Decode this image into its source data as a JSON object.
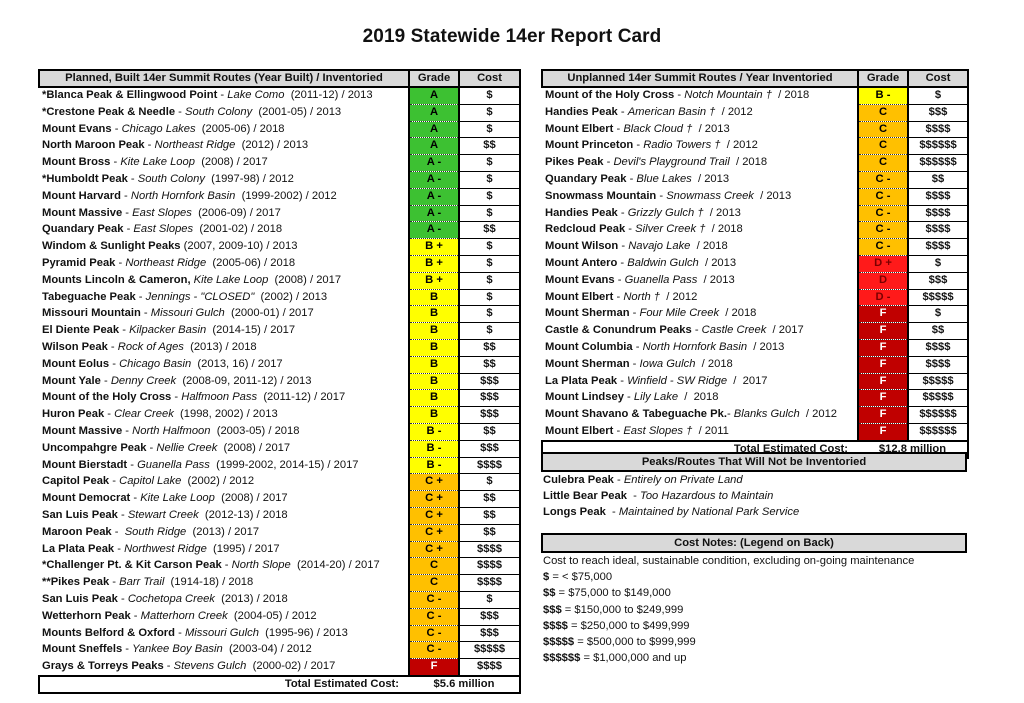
{
  "title": "2019 Statewide 14er Report Card",
  "colors": {
    "A": "#3dc132",
    "B": "#ffff00",
    "C": "#ffc000",
    "D": "#ff1a1a",
    "F": "#c00000",
    "header_bg": "#d9d9d9"
  },
  "planned": {
    "header": {
      "route": "Planned, Built 14er Summit Routes  (Year Built) / Inventoried",
      "grade": "Grade",
      "cost": "Cost"
    },
    "rows": [
      {
        "peak": "*Blanca Peak & Ellingwood Point",
        "sep": " - ",
        "route": "Lake Como",
        "years": "  (2011-12) / 2013",
        "grade": "A",
        "cost": "$"
      },
      {
        "peak": "*Crestone Peak & Needle",
        "sep": " - ",
        "route": "South Colony",
        "years": "  (2001-05) / 2013",
        "grade": "A",
        "cost": "$"
      },
      {
        "peak": "Mount Evans",
        "sep": " - ",
        "route": "Chicago Lakes",
        "years": "  (2005-06) / 2018",
        "grade": "A",
        "cost": "$"
      },
      {
        "peak": "North Maroon Peak",
        "sep": " - ",
        "route": "Northeast Ridge",
        "years": "  (2012) / 2013",
        "grade": "A",
        "cost": "$$"
      },
      {
        "peak": "Mount Bross",
        "sep": " - ",
        "route": "Kite Lake Loop",
        "years": "  (2008) / 2017",
        "grade": "A -",
        "cost": "$"
      },
      {
        "peak": "*Humboldt Peak",
        "sep": " - ",
        "route": "South Colony",
        "years": "  (1997-98) / 2012",
        "grade": "A -",
        "cost": "$"
      },
      {
        "peak": "Mount Harvard",
        "sep": " - ",
        "route": "North Hornfork Basin",
        "years": "  (1999-2002) / 2012",
        "grade": "A -",
        "cost": "$"
      },
      {
        "peak": "Mount Massive",
        "sep": " - ",
        "route": "East Slopes",
        "years": "  (2006-09) / 2017",
        "grade": "A -",
        "cost": "$"
      },
      {
        "peak": "Quandary Peak",
        "sep": " - ",
        "route": "East Slopes",
        "years": "  (2001-02) / 2018",
        "grade": "A -",
        "cost": "$$"
      },
      {
        "peak": "Windom & Sunlight Peaks",
        "sep": "",
        "route": "",
        "years": " (2007, 2009-10) / 2013",
        "grade": "B +",
        "cost": "$"
      },
      {
        "peak": "Pyramid Peak",
        "sep": " - ",
        "route": "Northeast Ridge",
        "years": "  (2005-06) / 2018",
        "grade": "B +",
        "cost": "$"
      },
      {
        "peak": "Mounts Lincoln & Cameron,",
        "sep": " ",
        "route": "Kite Lake Loop",
        "years": "  (2008) / 2017",
        "grade": "B +",
        "cost": "$"
      },
      {
        "peak": "Tabeguache Peak",
        "sep": " - ",
        "route": "Jennings - \"CLOSED\"",
        "years": "  (2002) / 2013",
        "grade": "B",
        "cost": "$"
      },
      {
        "peak": "Missouri Mountain",
        "sep": " - ",
        "route": "Missouri Gulch",
        "years": "  (2000-01) / 2017",
        "grade": "B",
        "cost": "$"
      },
      {
        "peak": "El Diente Peak",
        "sep": " - ",
        "route": "Kilpacker Basin",
        "years": "  (2014-15) / 2017",
        "grade": "B",
        "cost": "$"
      },
      {
        "peak": "Wilson Peak",
        "sep": " - ",
        "route": "Rock of Ages",
        "years": "  (2013) / 2018",
        "grade": "B",
        "cost": "$$"
      },
      {
        "peak": "Mount Eolus",
        "sep": " - ",
        "route": "Chicago Basin",
        "years": "  (2013, 16) / 2017",
        "grade": "B",
        "cost": "$$"
      },
      {
        "peak": "Mount Yale",
        "sep": " - ",
        "route": "Denny Creek",
        "years": "  (2008-09, 2011-12) / 2013",
        "grade": "B",
        "cost": "$$$"
      },
      {
        "peak": "Mount of the Holy Cross",
        "sep": " - ",
        "route": "Halfmoon Pass",
        "years": "  (2011-12) / 2017",
        "grade": "B",
        "cost": "$$$"
      },
      {
        "peak": "Huron Peak",
        "sep": " - ",
        "route": "Clear Creek",
        "years": "  (1998, 2002) / 2013",
        "grade": "B",
        "cost": "$$$"
      },
      {
        "peak": "Mount Massive",
        "sep": " - ",
        "route": "North Halfmoon",
        "years": "  (2003-05) / 2018",
        "grade": "B -",
        "cost": "$$"
      },
      {
        "peak": "Uncompahgre Peak",
        "sep": " - ",
        "route": "Nellie Creek",
        "years": "  (2008) / 2017",
        "grade": "B -",
        "cost": "$$$"
      },
      {
        "peak": "Mount Bierstadt",
        "sep": " - ",
        "route": "Guanella Pass",
        "years": "  (1999-2002, 2014-15) / 2017",
        "grade": "B -",
        "cost": "$$$$"
      },
      {
        "peak": "Capitol Peak",
        "sep": " - ",
        "route": "Capitol Lake",
        "years": "  (2002) / 2012",
        "grade": "C +",
        "cost": "$"
      },
      {
        "peak": "Mount Democrat",
        "sep": " - ",
        "route": "Kite Lake Loop",
        "years": "  (2008) / 2017",
        "grade": "C +",
        "cost": "$$"
      },
      {
        "peak": "San Luis Peak",
        "sep": " - ",
        "route": "Stewart Creek",
        "years": "  (2012-13) / 2018",
        "grade": "C +",
        "cost": "$$"
      },
      {
        "peak": "Maroon Peak",
        "sep": " -  ",
        "route": "South Ridge",
        "years": "  (2013) / 2017",
        "grade": "C +",
        "cost": "$$"
      },
      {
        "peak": "La Plata Peak",
        "sep": " - ",
        "route": "Northwest Ridge",
        "years": "  (1995) / 2017",
        "grade": "C +",
        "cost": "$$$$"
      },
      {
        "peak": "*Challenger Pt. & Kit Carson Peak",
        "sep": " - ",
        "route": "North Slope",
        "years": "  (2014-20) / 2017",
        "grade": "C",
        "cost": "$$$$"
      },
      {
        "peak": "**Pikes Peak",
        "sep": " - ",
        "route": "Barr Trail",
        "years": "  (1914-18) / 2018",
        "grade": "C",
        "cost": "$$$$"
      },
      {
        "peak": "San Luis Peak",
        "sep": " - ",
        "route": "Cochetopa Creek",
        "years": "  (2013) / 2018",
        "grade": "C -",
        "cost": "$"
      },
      {
        "peak": "Wetterhorn Peak",
        "sep": " - ",
        "route": "Matterhorn Creek",
        "years": "  (2004-05) / 2012",
        "grade": "C -",
        "cost": "$$$"
      },
      {
        "peak": "Mounts Belford & Oxford",
        "sep": " - ",
        "route": "Missouri Gulch",
        "years": "  (1995-96) / 2013",
        "grade": "C -",
        "cost": "$$$"
      },
      {
        "peak": "Mount Sneffels",
        "sep": " - ",
        "route": "Yankee Boy Basin",
        "years": "  (2003-04) / 2012",
        "grade": "C -",
        "cost": "$$$$$"
      },
      {
        "peak": "Grays & Torreys Peaks",
        "sep": " - ",
        "route": "Stevens Gulch",
        "years": "  (2000-02) / 2017",
        "grade": "F",
        "cost": "$$$$"
      }
    ],
    "total_label": "Total Estimated Cost:",
    "total_value": "$5.6 million"
  },
  "unplanned": {
    "header": {
      "route": "Unplanned 14er Summit Routes / Year Inventoried",
      "grade": "Grade",
      "cost": "Cost"
    },
    "rows": [
      {
        "peak": "Mount of the Holy Cross",
        "sep": " - ",
        "route": "Notch Mountain †",
        "years": "  / 2018",
        "grade": "B -",
        "cost": "$"
      },
      {
        "peak": "Handies  Peak",
        "sep": " - ",
        "route": "American Basin †",
        "years": "  / 2012",
        "grade": "C",
        "cost": "$$$"
      },
      {
        "peak": "Mount Elbert",
        "sep": " - ",
        "route": "Black Cloud †",
        "years": "  / 2013",
        "grade": "C",
        "cost": "$$$$"
      },
      {
        "peak": "Mount Princeton",
        "sep": " - ",
        "route": "Radio Towers †",
        "years": "  / 2012",
        "grade": "C",
        "cost": "$$$$$$"
      },
      {
        "peak": "Pikes Peak",
        "sep": " - ",
        "route": "Devil's Playground Trail",
        "years": "  / 2018",
        "grade": "C",
        "cost": "$$$$$$"
      },
      {
        "peak": "Quandary Peak",
        "sep": " - ",
        "route": "Blue Lakes",
        "years": "  / 2013",
        "grade": "C -",
        "cost": "$$"
      },
      {
        "peak": "Snowmass Mountain",
        "sep": " - ",
        "route": "Snowmass Creek",
        "years": "  / 2013",
        "grade": "C -",
        "cost": "$$$$"
      },
      {
        "peak": "Handies Peak",
        "sep": " - ",
        "route": "Grizzly Gulch †",
        "years": "  / 2013",
        "grade": "C -",
        "cost": "$$$$"
      },
      {
        "peak": "Redcloud Peak",
        "sep": " - ",
        "route": "Silver Creek †",
        "years": "  / 2018",
        "grade": "C -",
        "cost": "$$$$"
      },
      {
        "peak": "Mount Wilson",
        "sep": " - ",
        "route": "Navajo Lake",
        "years": "  / 2018",
        "grade": "C -",
        "cost": "$$$$"
      },
      {
        "peak": "Mount Antero",
        "sep": " - ",
        "route": "Baldwin Gulch",
        "years": "  / 2013",
        "grade": "D +",
        "cost": "$"
      },
      {
        "peak": "Mount Evans",
        "sep": " - ",
        "route": "Guanella Pass",
        "years": "  / 2013",
        "grade": "D",
        "cost": "$$$"
      },
      {
        "peak": "Mount Elbert",
        "sep": " - ",
        "route": "North †",
        "years": "  / 2012",
        "grade": "D -",
        "cost": "$$$$$"
      },
      {
        "peak": "Mount Sherman",
        "sep": " - ",
        "route": "Four Mile Creek",
        "years": "  / 2018",
        "grade": "F",
        "cost": "$"
      },
      {
        "peak": "Castle & Conundrum Peaks",
        "sep": " - ",
        "route": "Castle Creek",
        "years": "  / 2017",
        "grade": "F",
        "cost": "$$"
      },
      {
        "peak": "Mount Columbia",
        "sep": " - ",
        "route": "North Hornfork Basin",
        "years": "  / 2013",
        "grade": "F",
        "cost": "$$$$"
      },
      {
        "peak": "Mount Sherman",
        "sep": " - ",
        "route": "Iowa Gulch",
        "years": "  / 2018",
        "grade": "F",
        "cost": "$$$$"
      },
      {
        "peak": "La Plata Peak",
        "sep": " - ",
        "route": "Winfield - SW Ridge",
        "years": "  /  2017",
        "grade": "F",
        "cost": "$$$$$"
      },
      {
        "peak": "Mount Lindsey",
        "sep": " - ",
        "route": "Lily Lake",
        "years": "  /  2018",
        "grade": "F",
        "cost": "$$$$$"
      },
      {
        "peak": "Mount Shavano & Tabeguache Pk.",
        "sep": "- ",
        "route": "Blanks Gulch",
        "years": "  / 2012",
        "grade": "F",
        "cost": "$$$$$$"
      },
      {
        "peak": "Mount Elbert",
        "sep": " - ",
        "route": "East Slopes †",
        "years": "  / 2011",
        "grade": "F",
        "cost": "$$$$$$"
      }
    ],
    "total_label": "Total Estimated Cost:",
    "total_value": "$12.8 million"
  },
  "not_inventoried": {
    "header": "Peaks/Routes That Will Not be Inventoried",
    "items": [
      {
        "peak": "Culebra Peak",
        "sep": " - ",
        "reason": "Entirely on Private Land"
      },
      {
        "peak": "Little Bear Peak",
        "sep": "  - ",
        "reason": "Too Hazardous to Maintain"
      },
      {
        "peak": "Longs Peak",
        "sep": "  - ",
        "reason": "Maintained by National Park Service"
      }
    ]
  },
  "cost_notes": {
    "header": "Cost Notes: (Legend on Back)",
    "intro": "Cost to reach ideal, sustainable condition, excluding on-going maintenance",
    "legend": [
      {
        "symbol": "$",
        "range": " = < $75,000"
      },
      {
        "symbol": "$$",
        "range": " = $75,000 to $149,000"
      },
      {
        "symbol": "$$$",
        "range": " = $150,000 to $249,999"
      },
      {
        "symbol": "$$$$",
        "range": " = $250,000 to $499,999"
      },
      {
        "symbol": "$$$$$",
        "range": " = $500,000 to $999,999"
      },
      {
        "symbol": "$$$$$$",
        "range": " = $1,000,000 and up"
      }
    ]
  }
}
